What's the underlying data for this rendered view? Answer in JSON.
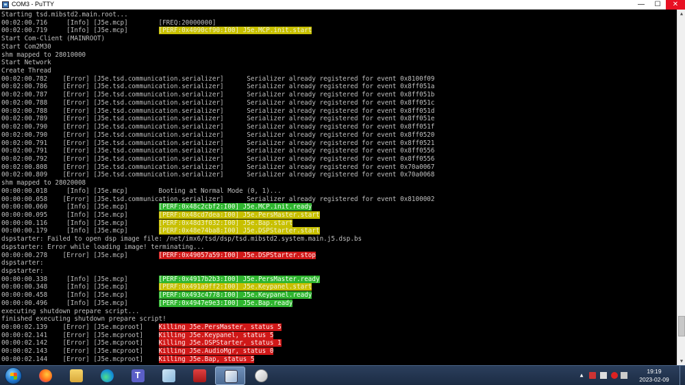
{
  "window": {
    "title": "COM3 - PuTTY",
    "minimize_label": "—",
    "maximize_label": "☐",
    "close_label": "✕"
  },
  "terminal": {
    "lines": [
      {
        "text": "Starting tsd.mibstd2.main.root..."
      },
      {
        "text": "00:02:00.716     [Info] [J5e.mcp]        [FREQ:20000000]"
      },
      {
        "text": "00:02:00.719     [Info] [J5e.mcp]        ",
        "hl": "[PERF:0x4090cf90:I00] J5e.MCP.init.start",
        "hl_color": "yellow"
      },
      {
        "text": "Start Com-Client (MAINROOT)"
      },
      {
        "text": "Start Com2M30"
      },
      {
        "text": "shm mapped to 28010000"
      },
      {
        "text": "Start Network"
      },
      {
        "text": "Create Thread"
      },
      {
        "text": "00:02:00.782    [Error] [J5e.tsd.communication.serializer]      Serializer already registered for event 0x8100f09"
      },
      {
        "text": "00:02:00.786    [Error] [J5e.tsd.communication.serializer]      Serializer already registered for event 0x8ff051a"
      },
      {
        "text": "00:02:00.787    [Error] [J5e.tsd.communication.serializer]      Serializer already registered for event 0x8ff051b"
      },
      {
        "text": "00:02:00.788    [Error] [J5e.tsd.communication.serializer]      Serializer already registered for event 0x8ff051c"
      },
      {
        "text": "00:02:00.788    [Error] [J5e.tsd.communication.serializer]      Serializer already registered for event 0x8ff051d"
      },
      {
        "text": "00:02:00.789    [Error] [J5e.tsd.communication.serializer]      Serializer already registered for event 0x8ff051e"
      },
      {
        "text": "00:02:00.790    [Error] [J5e.tsd.communication.serializer]      Serializer already registered for event 0x8ff051f"
      },
      {
        "text": "00:02:00.790    [Error] [J5e.tsd.communication.serializer]      Serializer already registered for event 0x8ff0520"
      },
      {
        "text": "00:02:00.791    [Error] [J5e.tsd.communication.serializer]      Serializer already registered for event 0x8ff0521"
      },
      {
        "text": "00:02:00.791    [Error] [J5e.tsd.communication.serializer]      Serializer already registered for event 0x8ff0556"
      },
      {
        "text": "00:02:00.792    [Error] [J5e.tsd.communication.serializer]      Serializer already registered for event 0x8ff0556"
      },
      {
        "text": "00:02:00.808    [Error] [J5e.tsd.communication.serializer]      Serializer already registered for event 0x70a0067"
      },
      {
        "text": "00:02:00.809    [Error] [J5e.tsd.communication.serializer]      Serializer already registered for event 0x70a0068"
      },
      {
        "text": "shm mapped to 28020008"
      },
      {
        "text": "00:00:00.018     [Info] [J5e.mcp]        Booting at Normal Mode (0, 1)..."
      },
      {
        "text": "00:00:00.058    [Error] [J5e.tsd.communication.serializer]      Serializer already registered for event 0x8100002"
      },
      {
        "text": "00:00:00.060     [Info] [J5e.mcp]        ",
        "hl": "[PERF:0x48c2cbf2:I00] J5e.MCP.init.ready",
        "hl_color": "green"
      },
      {
        "text": "00:00:00.095     [Info] [J5e.mcp]        ",
        "hl": "[PERF:0x48cd7dea:I00] J5e.PersMaster.start",
        "hl_color": "yellow"
      },
      {
        "text": "00:00:00.116     [Info] [J5e.mcp]        ",
        "hl": "[PERF:0x48d3f032:I00] J5e.Bap.start",
        "hl_color": "yellow"
      },
      {
        "text": "00:00:00.179     [Info] [J5e.mcp]        ",
        "hl": "[PERF:0x48e74ba8:I00] J5e.DSPStarter.start",
        "hl_color": "yellow"
      },
      {
        "text": "dspstarter: Failed to open dsp image file: /net/imx6/tsd/dsp/tsd.mibstd2.system.main.j5.dsp.bs"
      },
      {
        "text": "dspstarter: Error while loading image! terminating..."
      },
      {
        "text": "00:00:00.278    [Error] [J5e.mcp]        ",
        "hl": "[PERF:0x49057a59:I00] J5e.DSPStarter.stop",
        "hl_color": "red"
      },
      {
        "text": "dspstarter:"
      },
      {
        "text": "dspstarter:"
      },
      {
        "text": "00:00:00.338     [Info] [J5e.mcp]        ",
        "hl": "[PERF:0x4917b2b3:I00] J5e.PersMaster.ready",
        "hl_color": "green"
      },
      {
        "text": "00:00:00.348     [Info] [J5e.mcp]        ",
        "hl": "[PERF:0x491a9ff2:I00] J5e.Keypanel.start",
        "hl_color": "yellow"
      },
      {
        "text": "00:00:00.458     [Info] [J5e.mcp]        ",
        "hl": "[PERF:0x493c4778:I00] J5e.Keypanel.ready",
        "hl_color": "green"
      },
      {
        "text": "00:00:00.496     [Info] [J5e.mcp]        ",
        "hl": "[PERF:0x4947e9e3:I00] J5e.Bap.ready",
        "hl_color": "green"
      },
      {
        "text": "executing shutdown prepare script..."
      },
      {
        "text": "finished executing shutdown prepare script!"
      },
      {
        "text": "00:00:02.139    [Error] [J5e.mcproot]    ",
        "hl": "Killing J5e.PersMaster, status 5",
        "hl_color": "red"
      },
      {
        "text": "00:00:02.141    [Error] [J5e.mcproot]    ",
        "hl": "Killing J5e.Keypanel, status 5",
        "hl_color": "red"
      },
      {
        "text": "00:00:02.142    [Error] [J5e.mcproot]    ",
        "hl": "Killing J5e.DSPStarter, status 1",
        "hl_color": "red"
      },
      {
        "text": "00:00:02.143    [Error] [J5e.mcproot]    ",
        "hl": "Killing J5e.AudioMgr, status 0",
        "hl_color": "red"
      },
      {
        "text": "00:00:02.144    [Error] [J5e.mcproot]    ",
        "hl": "Killing J5e.Bap, status 5",
        "hl_color": "red"
      }
    ]
  },
  "colors": {
    "highlight_yellow": "#c8c000",
    "highlight_green": "#2fb52f",
    "highlight_red": "#d01818"
  },
  "taskbar": {
    "apps": [
      {
        "name": "firefox-icon"
      },
      {
        "name": "file-explorer-icon"
      },
      {
        "name": "edge-icon"
      },
      {
        "name": "teams-icon"
      },
      {
        "name": "photos-icon"
      },
      {
        "name": "toolbox-icon"
      },
      {
        "name": "putty-icon",
        "active": true
      },
      {
        "name": "paint-icon"
      }
    ],
    "tray_arrow": "▲",
    "clock_time": "19:19",
    "clock_date": "2023-02-09"
  }
}
